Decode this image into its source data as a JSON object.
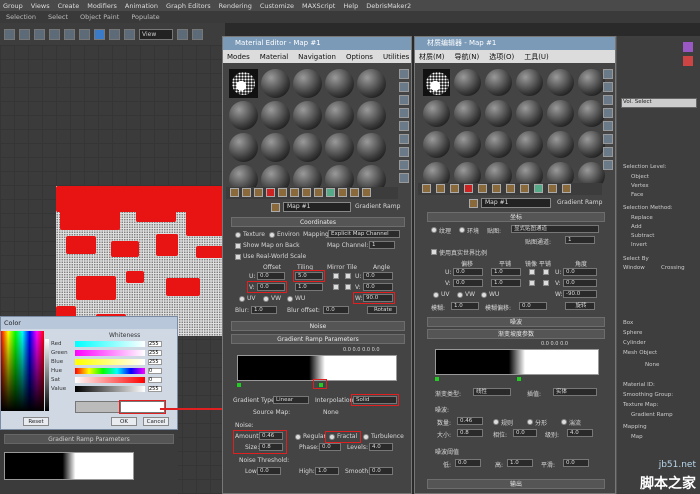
{
  "menubar": [
    "Group",
    "Views",
    "Create",
    "Modifiers",
    "Animation",
    "Graph Editors",
    "Rendering",
    "Customize",
    "MAXScript",
    "Help",
    "DebrisMaker2"
  ],
  "tabs": [
    "Selection",
    "Select",
    "Object Paint",
    "Populate"
  ],
  "toolbar": {
    "view_label": "View"
  },
  "color_dialog": {
    "title": "Color",
    "whiteness_label": "Whiteness",
    "channels": [
      {
        "label": "Red",
        "value": "255",
        "color": "#ff3b3b"
      },
      {
        "label": "Green",
        "value": "255",
        "color": "#3bd13b"
      },
      {
        "label": "Blue",
        "value": "255",
        "color": "#3b5bff"
      },
      {
        "label": "Hue",
        "value": "0",
        "color": "#ff00ff"
      },
      {
        "label": "Sat",
        "value": "0",
        "color": "#ff6060"
      },
      {
        "label": "Value",
        "value": "255",
        "color": "#ffffff"
      }
    ],
    "reset_label": "Reset",
    "ok_label": "OK",
    "cancel_label": "Cancel"
  },
  "left_bottom": {
    "rollout": "Gradient Ramp Parameters"
  },
  "material_editor_en": {
    "title": "Material Editor - Map #1",
    "menu": [
      "Modes",
      "Material",
      "Navigation",
      "Options",
      "Utilities"
    ],
    "map_name": "Map #1",
    "map_type": "Gradient Ramp",
    "coordinates": {
      "title": "Coordinates",
      "texture": "Texture",
      "environ": "Environ",
      "mapping_label": "Mapping:",
      "mapping_value": "Explicit Map Channel",
      "show_map": "Show Map on Back",
      "map_channel_label": "Map Channel:",
      "map_channel_value": "1",
      "use_real_world": "Use Real-World Scale",
      "offset": "Offset",
      "tiling": "Tiling",
      "mirror_tile": "Mirror Tile",
      "angle": "Angle",
      "u": "U:",
      "v": "V:",
      "w": "W:",
      "u_offset": "0.0",
      "v_offset": "0.0",
      "u_tiling": "5.0",
      "v_tiling": "1.0",
      "u_angle": "0.0",
      "v_angle": "0.0",
      "w_angle": "90.0",
      "uv": "UV",
      "vw": "VW",
      "wu": "WU",
      "blur_label": "Blur:",
      "blur_value": "1.0",
      "blur_offset_label": "Blur offset:",
      "blur_offset_value": "0.0",
      "rotate": "Rotate"
    },
    "noise_rollout": "Noise",
    "gradient_rollout": "Gradient Ramp Parameters",
    "grad_numbers": "0.0  0.0  0.0  0.0",
    "gradient_type_label": "Gradient Type:",
    "gradient_type_value": "Linear",
    "interpolation_label": "Interpolation:",
    "interpolation_value": "Solid",
    "source_map": "Source Map:",
    "none": "None",
    "noise_label": "Noise:",
    "amount_label": "Amount:",
    "amount_value": "0.46",
    "regular": "Regular",
    "fractal": "Fractal",
    "turbulence": "Turbulence",
    "size_label": "Size:",
    "size_value": "0.8",
    "phase_label": "Phase:",
    "phase_value": "0.0",
    "levels_label": "Levels:",
    "levels_value": "4.0",
    "noise_threshold": "Noise Threshold:",
    "low_label": "Low:",
    "low_value": "0.0",
    "high_label": "High:",
    "high_value": "1.0",
    "smooth_label": "Smooth:",
    "smooth_value": "0.0"
  },
  "material_editor_cn": {
    "title": "材质编辑器 - Map #1",
    "menu": [
      "材质(M)",
      "导航(N)",
      "选项(O)",
      "工具(U)"
    ],
    "map_name": "Map #1",
    "map_type": "Gradient Ramp",
    "coordinates": "坐标",
    "texture": "纹理",
    "environ": "环境",
    "mapping_label": "贴图:",
    "mapping_value": "显式贴图通道",
    "map_channel": "贴图通道:",
    "map_channel_value": "1",
    "real_world": "使用真实世界比例",
    "offset": "偏移",
    "tiling": "平铺",
    "mirror_tile": "镜像 平铺",
    "angle": "角度",
    "u": "U:",
    "v": "V:",
    "w": "W:",
    "u_offset": "0.0",
    "v_offset": "0.0",
    "u_tiling": "1.0",
    "v_tiling": "1.0",
    "u_angle": "0.0",
    "v_angle": "0.0",
    "w_angle": "-90.0",
    "uv": "UV",
    "vw": "VW",
    "wu": "WU",
    "blur_label": "模糊:",
    "blur_value": "1.0",
    "blur_offset_label": "模糊偏移:",
    "blur_offset_value": "0.0",
    "rotate": "旋转",
    "noise_rollout": "噪波",
    "gradient_rollout": "渐变坡度参数",
    "grad_numbers": "0.0  0.0  0.0",
    "gradient_type_label": "渐变类型:",
    "gradient_type_value": "线性",
    "interpolation_label": "插值:",
    "interpolation_value": "实体",
    "noise_label": "噪波:",
    "amount_label": "数量:",
    "amount_value": "0.46",
    "regular": "规则",
    "fractal": "分形",
    "turbulence": "湍流",
    "size_label": "大小:",
    "size_value": "0.8",
    "phase_label": "相位:",
    "phase_value": "0.0",
    "levels_label": "级别:",
    "levels_value": "4.0",
    "noise_threshold": "噪波阈值",
    "low_label": "低:",
    "low_value": "0.0",
    "high_label": "高:",
    "high_value": "1.0",
    "smooth_label": "平滑:",
    "smooth_value": "0.0",
    "output": "输出"
  },
  "command_panel": {
    "items": [
      "Vol. Select",
      "Selection Level:",
      "Object",
      "Vertex",
      "Face",
      "Selection Method:",
      "Replace",
      "Add",
      "Subtract",
      "Invert",
      "Select By",
      "Window",
      "Crossing",
      "Box",
      "Sphere",
      "Cylinder",
      "Mesh Object",
      "None",
      "Material ID:",
      "Smoothing Group:",
      "Texture Map:",
      "Gradient Ramp",
      "Mapping",
      "Map"
    ]
  },
  "watermark": {
    "line1": "jb51.net",
    "line2": "脚本之家"
  }
}
